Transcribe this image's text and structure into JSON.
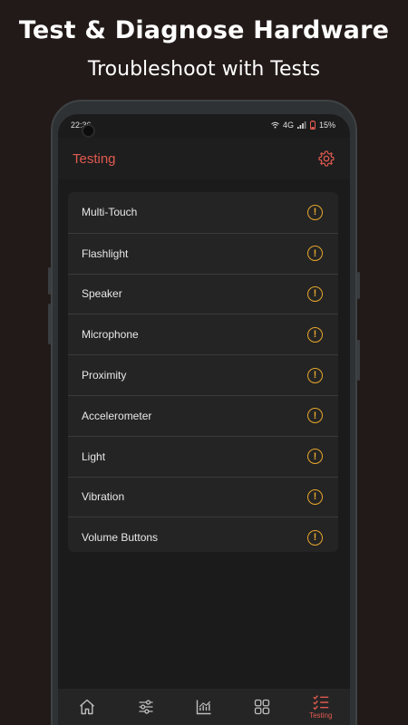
{
  "promo": {
    "headline": "Test & Diagnose Hardware",
    "subheadline": "Troubleshoot with Tests"
  },
  "status_bar": {
    "time": "22:36",
    "network": "4G",
    "battery": "15%"
  },
  "app_bar": {
    "title": "Testing",
    "settings_icon": "gear-icon"
  },
  "tests": [
    {
      "label": "Multi-Touch",
      "status_icon": "warning-icon"
    },
    {
      "label": "Flashlight",
      "status_icon": "warning-icon"
    },
    {
      "label": "Speaker",
      "status_icon": "warning-icon"
    },
    {
      "label": "Microphone",
      "status_icon": "warning-icon"
    },
    {
      "label": "Proximity",
      "status_icon": "warning-icon"
    },
    {
      "label": "Accelerometer",
      "status_icon": "warning-icon"
    },
    {
      "label": "Light",
      "status_icon": "warning-icon"
    },
    {
      "label": "Vibration",
      "status_icon": "warning-icon"
    },
    {
      "label": "Volume Buttons",
      "status_icon": "warning-icon"
    }
  ],
  "bottom_nav": {
    "items": [
      {
        "icon": "home-icon",
        "label": ""
      },
      {
        "icon": "sliders-icon",
        "label": ""
      },
      {
        "icon": "chart-icon",
        "label": ""
      },
      {
        "icon": "grid-icon",
        "label": ""
      },
      {
        "icon": "checklist-icon",
        "label": "Testing"
      }
    ],
    "active_index": 4
  },
  "colors": {
    "accent": "#e05a50",
    "warning": "#e7a72d",
    "background": "#221a18",
    "surface": "#242424"
  }
}
